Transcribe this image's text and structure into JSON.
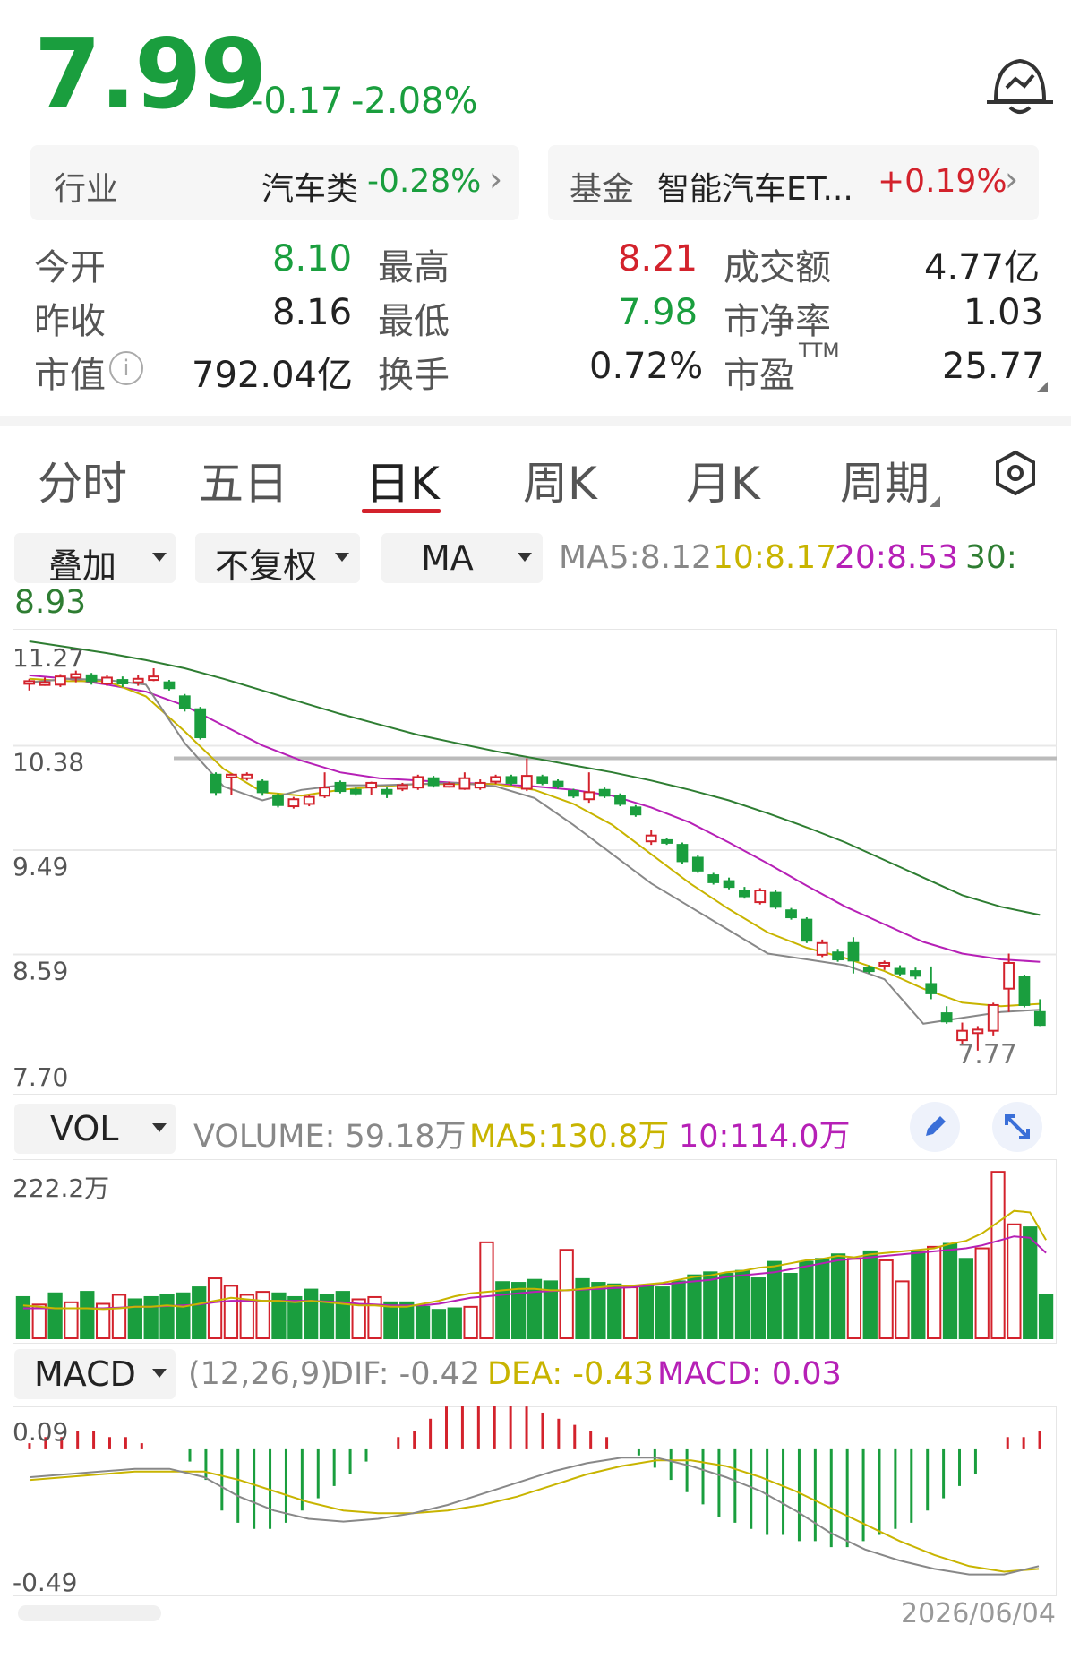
{
  "quote": {
    "price": "7.99",
    "change": "-0.17",
    "change_pct": "-2.08%"
  },
  "industry": {
    "label": "行业",
    "name": "汽车类",
    "change": "-0.28%"
  },
  "fund": {
    "label": "基金",
    "name": "智能汽车ET...",
    "change": "+0.19%"
  },
  "stats": {
    "open_label": "今开",
    "open": "8.10",
    "high_label": "最高",
    "high": "8.21",
    "turnover_amt_label": "成交额",
    "turnover_amt": "4.77亿",
    "prev_close_label": "昨收",
    "prev_close": "8.16",
    "low_label": "最低",
    "low": "7.98",
    "pb_label": "市净率",
    "pb": "1.03",
    "mcap_label": "市值",
    "mcap": "792.04亿",
    "turnover_label": "换手",
    "turnover": "0.72%",
    "pe_label": "市盈",
    "pe_sup": "TTM",
    "pe": "25.77"
  },
  "tabs": [
    "分时",
    "五日",
    "日K",
    "周K",
    "月K",
    "周期"
  ],
  "active_tab": "日K",
  "toolbar": {
    "overlay": "叠加",
    "adjust": "不复权",
    "indicator": "MA"
  },
  "ma_legend": {
    "ma5": "MA5:8.12",
    "ma10": "10:8.17",
    "ma20": "20:8.53",
    "ma30_label": "30:",
    "ma30": "8.93"
  },
  "vol_legend": {
    "selector": "VOL",
    "volume": "VOLUME: 59.18万",
    "ma5": "MA5:130.8万",
    "ma10": "10:114.0万"
  },
  "macd_legend": {
    "selector": "MACD",
    "params": "(12,26,9)",
    "dif": "DIF: -0.42",
    "dea": "DEA: -0.43",
    "macd": "MACD: 0.03"
  },
  "date_label": "2026/06/04",
  "colors": {
    "up": "#d3222c",
    "down": "#1a9e3e",
    "ma5": "#888888",
    "ma10": "#c8b400",
    "ma20": "#b620b6",
    "ma30": "#2e7d32"
  },
  "chart_data": [
    {
      "type": "candlestick",
      "y_ticks": [
        "11.27",
        "10.38",
        "9.49",
        "8.59",
        "7.70"
      ],
      "ylim": [
        7.7,
        11.27
      ],
      "low_label": "7.77",
      "candles": [
        [
          10.91,
          10.93,
          10.85,
          10.95
        ],
        [
          10.92,
          10.92,
          10.89,
          10.96
        ],
        [
          10.9,
          10.97,
          10.88,
          10.99
        ],
        [
          10.96,
          10.99,
          10.92,
          11.02
        ],
        [
          10.98,
          10.93,
          10.9,
          11.0
        ],
        [
          10.91,
          10.96,
          10.89,
          10.98
        ],
        [
          10.94,
          10.91,
          10.88,
          10.97
        ],
        [
          10.92,
          10.95,
          10.89,
          10.98
        ],
        [
          10.94,
          10.97,
          10.93,
          11.04
        ],
        [
          10.92,
          10.87,
          10.85,
          10.94
        ],
        [
          10.8,
          10.7,
          10.67,
          10.82
        ],
        [
          10.69,
          10.45,
          10.43,
          10.71
        ],
        [
          10.13,
          9.98,
          9.95,
          10.15
        ],
        [
          10.11,
          10.13,
          9.96,
          10.14
        ],
        [
          10.1,
          10.13,
          10.08,
          10.15
        ],
        [
          10.07,
          9.98,
          9.95,
          10.09
        ],
        [
          9.95,
          9.87,
          9.85,
          9.97
        ],
        [
          9.86,
          9.92,
          9.84,
          9.94
        ],
        [
          9.88,
          9.94,
          9.86,
          9.96
        ],
        [
          9.95,
          10.02,
          9.93,
          10.15
        ],
        [
          10.06,
          9.99,
          9.97,
          10.08
        ],
        [
          10.0,
          9.97,
          9.95,
          10.02
        ],
        [
          10.02,
          10.06,
          9.96,
          10.07
        ],
        [
          10.0,
          9.97,
          9.93,
          10.02
        ],
        [
          10.01,
          10.04,
          9.99,
          10.06
        ],
        [
          10.02,
          10.11,
          10.0,
          10.13
        ],
        [
          10.1,
          10.04,
          10.02,
          10.12
        ],
        [
          10.04,
          10.05,
          10.02,
          10.07
        ],
        [
          10.01,
          10.1,
          10.0,
          10.15
        ],
        [
          10.02,
          10.06,
          10.0,
          10.09
        ],
        [
          10.07,
          10.11,
          10.05,
          10.13
        ],
        [
          10.11,
          10.06,
          10.04,
          10.13
        ],
        [
          10.01,
          10.12,
          9.99,
          10.27
        ],
        [
          10.11,
          10.06,
          10.04,
          10.13
        ],
        [
          10.07,
          10.03,
          10.01,
          10.09
        ],
        [
          9.99,
          9.95,
          9.93,
          10.01
        ],
        [
          9.92,
          9.98,
          9.89,
          10.15
        ],
        [
          10.0,
          9.95,
          9.93,
          10.02
        ],
        [
          9.95,
          9.88,
          9.86,
          9.97
        ],
        [
          9.85,
          9.79,
          9.77,
          9.87
        ],
        [
          9.56,
          9.61,
          9.53,
          9.66
        ],
        [
          9.57,
          9.55,
          9.53,
          9.59
        ],
        [
          9.53,
          9.39,
          9.37,
          9.55
        ],
        [
          9.42,
          9.31,
          9.29,
          9.44
        ],
        [
          9.27,
          9.21,
          9.19,
          9.29
        ],
        [
          9.22,
          9.17,
          9.15,
          9.25
        ],
        [
          9.14,
          9.09,
          9.07,
          9.17
        ],
        [
          9.04,
          9.14,
          9.02,
          9.16
        ],
        [
          9.12,
          9.0,
          8.98,
          9.14
        ],
        [
          8.97,
          8.91,
          8.89,
          8.99
        ],
        [
          8.89,
          8.71,
          8.69,
          8.91
        ],
        [
          8.59,
          8.69,
          8.57,
          8.72
        ],
        [
          8.61,
          8.55,
          8.53,
          8.64
        ],
        [
          8.69,
          8.54,
          8.43,
          8.74
        ],
        [
          8.48,
          8.45,
          8.43,
          8.5
        ],
        [
          8.5,
          8.52,
          8.46,
          8.54
        ],
        [
          8.47,
          8.43,
          8.41,
          8.5
        ],
        [
          8.45,
          8.41,
          8.38,
          8.48
        ],
        [
          8.34,
          8.26,
          8.21,
          8.49
        ],
        [
          8.09,
          8.02,
          8.0,
          8.15
        ],
        [
          7.86,
          7.94,
          7.83,
          8.01
        ],
        [
          7.92,
          7.95,
          7.77,
          7.98
        ],
        [
          7.94,
          8.16,
          7.9,
          8.18
        ],
        [
          8.3,
          8.52,
          8.1,
          8.6
        ],
        [
          8.4,
          8.16,
          8.14,
          8.42
        ],
        [
          8.1,
          7.99,
          7.98,
          8.21
        ]
      ],
      "lines_points_per_series": 15,
      "ma5": [
        10.92,
        10.95,
        10.94,
        10.9,
        10.4,
        10.03,
        9.91,
        10.0,
        10.04,
        10.04,
        10.05,
        10.06,
        10.03,
        9.93,
        9.7,
        9.45,
        9.2,
        9.0,
        8.8,
        8.6,
        8.55,
        8.5,
        8.38,
        8.0,
        8.05,
        8.1,
        8.12
      ],
      "ma10": [
        10.95,
        10.93,
        10.93,
        10.8,
        10.5,
        10.18,
        9.98,
        9.95,
        10.0,
        10.03,
        10.05,
        10.05,
        10.05,
        10.0,
        9.88,
        9.7,
        9.45,
        9.2,
        8.98,
        8.78,
        8.65,
        8.56,
        8.45,
        8.3,
        8.18,
        8.15,
        8.17
      ],
      "ma20": [
        10.98,
        10.95,
        10.9,
        10.84,
        10.72,
        10.55,
        10.38,
        10.25,
        10.15,
        10.1,
        10.08,
        10.06,
        10.05,
        10.03,
        10.0,
        9.95,
        9.85,
        9.72,
        9.55,
        9.37,
        9.18,
        9.0,
        8.85,
        8.7,
        8.6,
        8.55,
        8.53
      ],
      "ma30": [
        11.27,
        11.22,
        11.17,
        11.11,
        11.04,
        10.95,
        10.85,
        10.75,
        10.65,
        10.56,
        10.47,
        10.4,
        10.33,
        10.27,
        10.21,
        10.15,
        10.08,
        10.0,
        9.91,
        9.8,
        9.68,
        9.55,
        9.4,
        9.25,
        9.1,
        9.0,
        8.93
      ]
    },
    {
      "type": "bar",
      "title": "VOL",
      "y_max_label": "222.2万",
      "ymax": 222.2,
      "values": [
        55,
        45,
        60,
        48,
        62,
        46,
        58,
        52,
        55,
        58,
        60,
        68,
        80,
        70,
        58,
        62,
        60,
        55,
        65,
        58,
        62,
        52,
        55,
        48,
        48,
        42,
        38,
        40,
        42,
        128,
        75,
        74,
        78,
        76,
        118,
        79,
        74,
        72,
        68,
        70,
        68,
        76,
        84,
        88,
        86,
        90,
        80,
        102,
        86,
        102,
        106,
        112,
        106,
        116,
        104,
        76,
        116,
        122,
        126,
        106,
        120,
        222,
        152,
        148,
        58
      ],
      "up": [
        false,
        true,
        false,
        true,
        false,
        true,
        true,
        false,
        false,
        false,
        false,
        false,
        true,
        true,
        true,
        true,
        false,
        false,
        false,
        false,
        false,
        true,
        true,
        false,
        false,
        false,
        false,
        false,
        true,
        true,
        false,
        false,
        false,
        false,
        true,
        false,
        false,
        false,
        true,
        false,
        false,
        false,
        false,
        false,
        false,
        false,
        false,
        false,
        false,
        false,
        false,
        false,
        true,
        false,
        true,
        true,
        false,
        true,
        false,
        false,
        true,
        true,
        true,
        false,
        false
      ],
      "ma5": [
        44,
        42,
        40,
        40,
        40,
        39,
        40,
        42,
        42,
        44,
        42,
        46,
        50,
        54,
        52,
        50,
        50,
        48,
        50,
        48,
        46,
        44,
        44,
        42,
        42,
        46,
        50,
        56,
        60,
        62,
        64,
        66,
        66,
        64,
        64,
        66,
        68,
        70,
        70,
        72,
        74,
        78,
        82,
        84,
        88,
        90,
        94,
        96,
        100,
        104,
        106,
        110,
        108,
        112,
        114,
        116,
        118,
        120,
        126,
        130,
        140,
        155,
        170,
        168,
        131
      ],
      "ma10": [
        40,
        40,
        40,
        40,
        40,
        40,
        41,
        42,
        42,
        43,
        44,
        45,
        48,
        50,
        50,
        50,
        50,
        50,
        50,
        49,
        48,
        46,
        45,
        44,
        44,
        44,
        46,
        50,
        54,
        56,
        58,
        60,
        62,
        63,
        64,
        65,
        66,
        67,
        68,
        70,
        72,
        74,
        76,
        78,
        82,
        84,
        86,
        88,
        92,
        96,
        100,
        104,
        106,
        108,
        110,
        112,
        114,
        116,
        118,
        120,
        124,
        130,
        136,
        134,
        114
      ]
    },
    {
      "type": "bar",
      "title": "MACD",
      "y_max_label": "0.09",
      "y_min_label": "-0.49",
      "ylim": [
        -0.49,
        0.09
      ],
      "macd": [
        0.01,
        0.02,
        0.02,
        0.03,
        0.03,
        0.02,
        0.02,
        0.01,
        0,
        0,
        -0.02,
        -0.05,
        -0.1,
        -0.12,
        -0.13,
        -0.13,
        -0.12,
        -0.1,
        -0.08,
        -0.06,
        -0.04,
        -0.02,
        0,
        0.02,
        0.03,
        0.05,
        0.07,
        0.08,
        0.08,
        0.09,
        0.08,
        0.07,
        0.06,
        0.05,
        0.04,
        0.03,
        0.02,
        0,
        -0.01,
        -0.03,
        -0.05,
        -0.07,
        -0.09,
        -0.11,
        -0.12,
        -0.13,
        -0.14,
        -0.14,
        -0.15,
        -0.15,
        -0.16,
        -0.16,
        -0.15,
        -0.14,
        -0.13,
        -0.12,
        -0.1,
        -0.08,
        -0.06,
        -0.04,
        0,
        0.02,
        0.02,
        0.03
      ],
      "dif": [
        -0.1,
        -0.09,
        -0.08,
        -0.07,
        -0.07,
        -0.1,
        -0.17,
        -0.22,
        -0.25,
        -0.26,
        -0.25,
        -0.23,
        -0.2,
        -0.16,
        -0.12,
        -0.08,
        -0.05,
        -0.03,
        -0.03,
        -0.06,
        -0.1,
        -0.15,
        -0.22,
        -0.3,
        -0.36,
        -0.4,
        -0.43,
        -0.45,
        -0.45,
        -0.42
      ],
      "dea": [
        -0.11,
        -0.1,
        -0.09,
        -0.08,
        -0.08,
        -0.08,
        -0.11,
        -0.15,
        -0.19,
        -0.22,
        -0.23,
        -0.23,
        -0.22,
        -0.2,
        -0.17,
        -0.13,
        -0.09,
        -0.06,
        -0.04,
        -0.04,
        -0.06,
        -0.1,
        -0.15,
        -0.21,
        -0.27,
        -0.33,
        -0.38,
        -0.42,
        -0.44,
        -0.43
      ]
    }
  ]
}
